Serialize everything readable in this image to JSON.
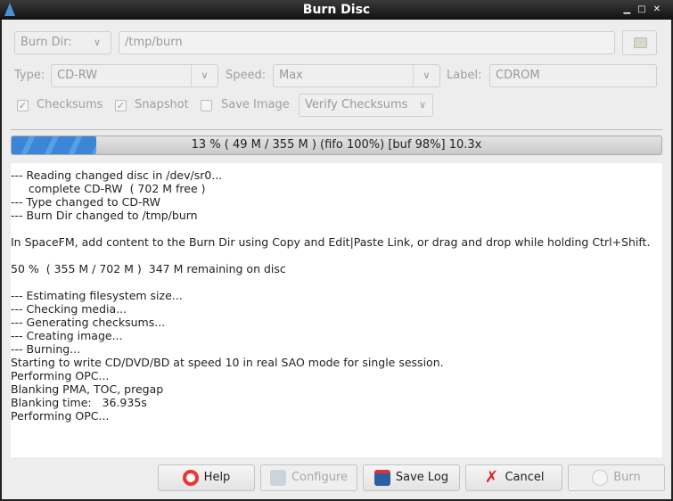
{
  "window": {
    "title": "Burn Disc"
  },
  "burn_dir": {
    "mode": "Burn Dir:",
    "path": "/tmp/burn"
  },
  "type": {
    "label": "Type:",
    "value": "CD-RW"
  },
  "speed": {
    "label": "Speed:",
    "value": "Max"
  },
  "disc_label": {
    "label": "Label:",
    "value": "CDROM"
  },
  "options": {
    "checksums": "Checksums",
    "snapshot": "Snapshot",
    "save_image": "Save Image",
    "verify": "Verify Checksums"
  },
  "progress": {
    "percent": 13,
    "text": "13 % ( 49 M / 355 M ) (fifo 100%) [buf  98%]  10.3x"
  },
  "log": [
    "--- Reading changed disc in /dev/sr0...",
    "     complete CD-RW  ( 702 M free )",
    "--- Type changed to CD-RW",
    "--- Burn Dir changed to /tmp/burn",
    "",
    "In SpaceFM, add content to the Burn Dir using Copy and Edit|Paste Link, or drag and drop while holding Ctrl+Shift.",
    "",
    "50 %  ( 355 M / 702 M )  347 M remaining on disc",
    "",
    "--- Estimating filesystem size...",
    "--- Checking media...",
    "--- Generating checksums...",
    "--- Creating image...",
    "--- Burning...",
    "Starting to write CD/DVD/BD at speed 10 in real SAO mode for single session.",
    "Performing OPC...",
    "Blanking PMA, TOC, pregap",
    "Blanking time:   36.935s",
    "Performing OPC..."
  ],
  "buttons": {
    "help": "Help",
    "configure": "Configure",
    "save_log": "Save Log",
    "cancel": "Cancel",
    "burn": "Burn"
  }
}
